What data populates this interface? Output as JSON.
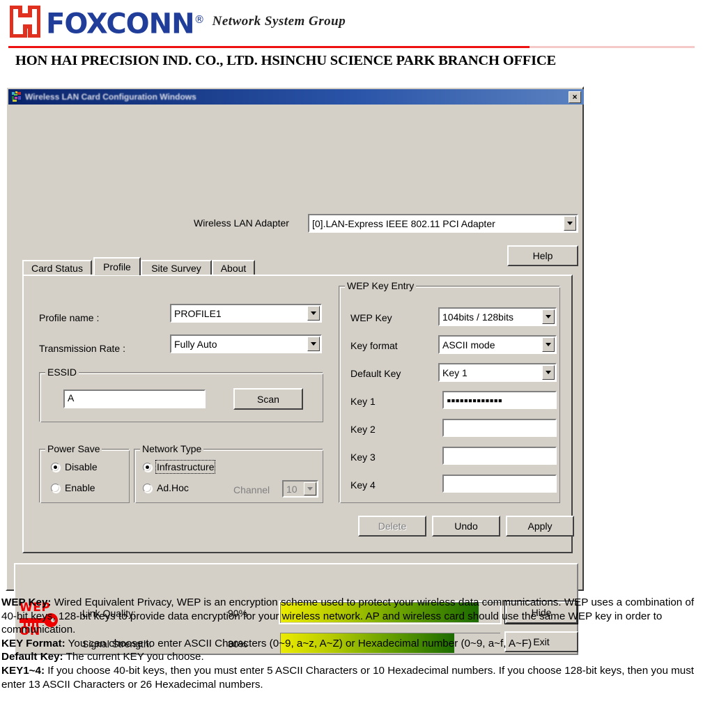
{
  "letterhead": {
    "brand": "FOXCONN",
    "registered": "®",
    "tagline": "Network  System  Group",
    "company_line": "HON HAI PRECISION IND. CO., LTD. HSINCHU SCIENCE PARK BRANCH OFFICE",
    "rule_color": "#ee1111",
    "brand_color": "#1f3d99",
    "logo_color": "#e03020"
  },
  "window": {
    "title": "Wireless LAN Card Configuration Windows",
    "close_label": "×",
    "adapter_label": "Wireless LAN Adapter",
    "adapter_value": "[0].LAN-Express IEEE 802.11 PCI Adapter",
    "help_label": "Help"
  },
  "tabs": [
    {
      "label": "Card Status",
      "active": false
    },
    {
      "label": "Profile",
      "active": true
    },
    {
      "label": "Site Survey",
      "active": false
    },
    {
      "label": "About",
      "active": false
    }
  ],
  "profile": {
    "profile_name_label": "Profile name :",
    "profile_name_value": "PROFILE1",
    "rate_label": "Transmission Rate :",
    "rate_value": "Fully Auto",
    "essid_group": "ESSID",
    "essid_value": "A",
    "scan_label": "Scan",
    "power_save_group": "Power Save",
    "power_save_disable": "Disable",
    "power_save_enable": "Enable",
    "power_save_selected": "Disable",
    "network_type_group": "Network Type",
    "network_infrastructure": "Infrastructure",
    "network_adhoc": "Ad.Hoc",
    "network_selected": "Infrastructure",
    "channel_label": "Channel",
    "channel_value": "10"
  },
  "wep": {
    "group_label": "WEP Key Entry",
    "wep_key_label": "WEP Key",
    "wep_key_value": "104bits / 128bits",
    "key_format_label": "Key format",
    "key_format_value": "ASCII mode",
    "default_key_label": "Default Key",
    "default_key_value": "Key 1",
    "keys": [
      {
        "label": "Key 1",
        "value": "▪▪▪▪▪▪▪▪▪▪▪▪▪"
      },
      {
        "label": "Key 2",
        "value": ""
      },
      {
        "label": "Key 3",
        "value": ""
      },
      {
        "label": "Key 4",
        "value": ""
      }
    ],
    "delete_label": "Delete",
    "undo_label": "Undo",
    "apply_label": "Apply"
  },
  "status": {
    "radio_state": "Radio On",
    "radio_toggle": "Radio On/Off",
    "hide_label": "Hide",
    "exit_label": "Exit",
    "link_quality_label": "Link Quality:",
    "link_quality_value": "90%",
    "link_quality_pct": 90,
    "signal_strength_label": "Signal Strength:",
    "signal_strength_value": "80%",
    "signal_strength_pct": 80,
    "wep_icon_top": "WEP",
    "wep_icon_bottom": "ON",
    "wep_icon_color": "#ee0000"
  },
  "notes": {
    "wep_key_term": "WEP Key:",
    "wep_key_text": " Wired Equivalent Privacy, WEP is an encryption scheme used to protect your wireless data communications. WEP uses a combination of 40-bit keys, 128-bit keys to provide data encryption for your wireless network. AP and wireless card should use the same WEP key in order to communication.",
    "key_format_term": "KEY Format:",
    "key_format_text": " You can choose to enter ASCII Characters (0~9, a~z, A~Z) or Hexadecimal number (0~9, a~f, A~F)",
    "default_key_term": "Default Key:",
    "default_key_text": " The current KEY you choose.",
    "key14_term": "KEY1~4:",
    "key14_text": " If you choose 40-bit keys, then you must enter 5 ASCII Characters or 10 Hexadecimal numbers. If you choose 128-bit keys, then you must enter 13 ASCII Characters or 26 Hexadecimal numbers."
  }
}
